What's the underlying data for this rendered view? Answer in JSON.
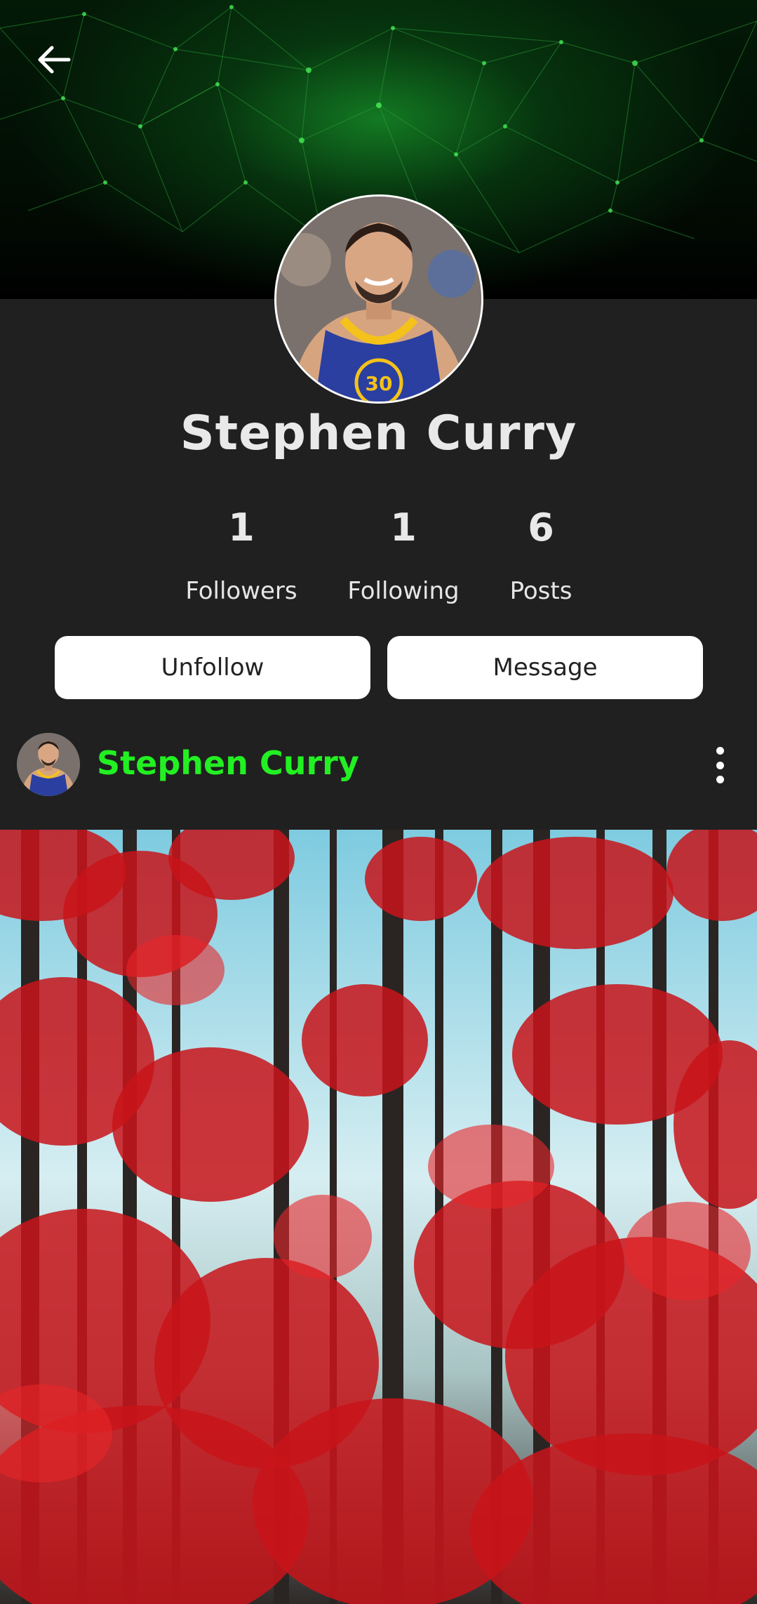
{
  "header": {
    "back_icon": "arrow-left-icon"
  },
  "profile": {
    "name": "Stephen Curry",
    "avatar": "profile-photo"
  },
  "stats": [
    {
      "value": "1",
      "label": "Followers"
    },
    {
      "value": "1",
      "label": "Following"
    },
    {
      "value": "6",
      "label": "Posts"
    }
  ],
  "actions": {
    "unfollow_label": "Unfollow",
    "message_label": "Message"
  },
  "post": {
    "author": "Stephen Curry",
    "more_icon": "more-vertical-icon",
    "image": "autumn-forest-photo"
  },
  "colors": {
    "background": "#202020",
    "accent_green": "#22f022",
    "button_bg": "#ffffff",
    "text": "#e9e9e9"
  }
}
